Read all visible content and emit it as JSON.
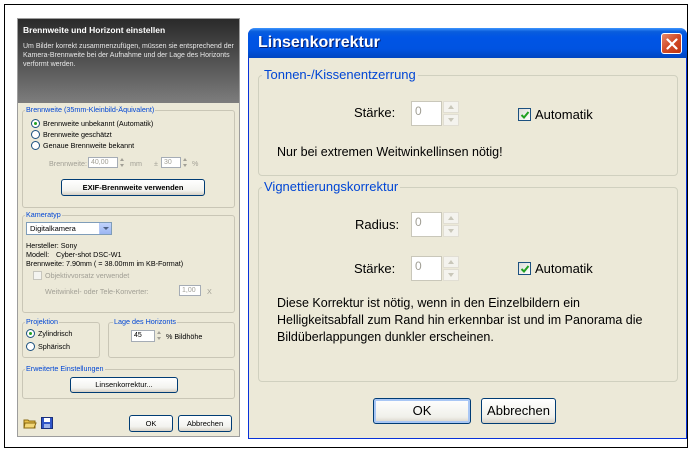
{
  "left_panel": {
    "title": "Brennweite und Horizont einstellen",
    "description": "Um Bilder korrekt zusammenzufügen, müssen sie entsprechend der Kamera-Brennweite bei der Aufnahme und der Lage des Horizonts verformt werden.",
    "focal_group": {
      "label": "Brennweite (35mm-Kleinbild-Äquivalent)",
      "options": [
        "Brennweite unbekannt (Automatik)",
        "Brennweite geschätzt",
        "Genaue Brennweite bekannt"
      ],
      "focal_label": "Brennweite:",
      "focal_value": "40,00",
      "focal_unit": "mm",
      "tolerance_prefix": "±",
      "tolerance_value": "30",
      "tolerance_unit": "%",
      "exif_button": "EXIF-Brennweite verwenden"
    },
    "camera_group": {
      "label": "Kameratyp",
      "camera_type": "Digitalkamera",
      "maker": "Hersteller: Sony",
      "model_label": "Modell:",
      "model_value": "Cyber-shot DSC-W1",
      "focal_info": "Brennweite: 7.90mm ( = 38.00mm im KB-Format)",
      "lens_adapter": "Objektivvorsatz verwendet",
      "converter_label": "Weitwinkel- oder Tele-Konverter:",
      "converter_value": "1,00",
      "converter_unit": "X"
    },
    "projection_group": {
      "label": "Projektion",
      "options": [
        "Zylindrisch",
        "Sphärisch"
      ]
    },
    "horizon_group": {
      "label": "Lage des Horizonts",
      "value": "45",
      "unit": "% Bildhöhe"
    },
    "advanced_group": {
      "label": "Erweiterte Einstellungen",
      "button": "Linsenkorrektur..."
    },
    "ok_button": "OK",
    "cancel_button": "Abbrechen"
  },
  "dialog": {
    "title": "Linsenkorrektur",
    "distortion": {
      "legend": "Tonnen-/Kissenentzerrung",
      "strength_label": "Stärke:",
      "strength_value": "0",
      "auto_label": "Automatik",
      "note": "Nur bei extremen Weitwinkellinsen nötig!"
    },
    "vignetting": {
      "legend": "Vignettierungskorrektur",
      "radius_label": "Radius:",
      "radius_value": "0",
      "strength_label": "Stärke:",
      "strength_value": "0",
      "auto_label": "Automatik",
      "note": "Diese Korrektur ist nötig, wenn in den Einzelbildern ein Helligkeitsabfall zum Rand hin erkennbar ist und im Panorama die Bildüberlappungen dunkler erscheinen."
    },
    "ok_button": "OK",
    "cancel_button": "Abbrechen"
  },
  "colors": {
    "titlebar": "#0055e5",
    "group_label": "#0046d5",
    "dialog_bg": "#ece9d8",
    "close_button": "#d24a26"
  }
}
